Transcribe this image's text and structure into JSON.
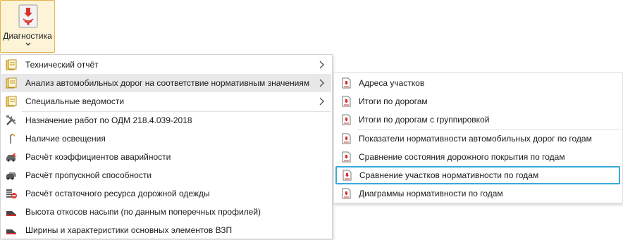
{
  "ribbon": {
    "label": "Диагностика"
  },
  "main_menu": {
    "items": [
      {
        "label": "Технический отчёт",
        "icon": "report-stack-icon",
        "submenu": true
      },
      {
        "label": "Анализ автомобильных дорог на соответствие нормативным значениям",
        "icon": "report-stack-icon",
        "submenu": true,
        "highlighted": true
      },
      {
        "label": "Специальные ведомости",
        "icon": "report-stack-icon",
        "submenu": true
      },
      {
        "label": "Назначение работ по ОДМ 218.4.039-2018",
        "icon": "tools-icon"
      },
      {
        "label": "Наличие освещения",
        "icon": "street-light-icon"
      },
      {
        "label": "Расчёт коэффициентов аварийности",
        "icon": "accident-icon"
      },
      {
        "label": "Расчёт пропускной способности",
        "icon": "car-traffic-icon"
      },
      {
        "label": "Расчёт остаточного ресурса дорожной одежды",
        "icon": "pavement-resource-icon"
      },
      {
        "label": "Высота откосов насыпи (по данным поперечных профилей)",
        "icon": "road-profile-icon"
      },
      {
        "label": "Ширины и характеристики основных элементов ВЗП",
        "icon": "road-profile-icon"
      }
    ]
  },
  "sub_menu": {
    "items": [
      {
        "label": "Адреса участков",
        "icon": "document-icon"
      },
      {
        "label": "Итоги по дорогам",
        "icon": "document-icon"
      },
      {
        "label": "Итоги по дорогам с группировкой",
        "icon": "document-icon"
      },
      {
        "label": "Показатели нормативности автомобильных дорог по годам",
        "icon": "document-icon"
      },
      {
        "label": "Сравнение состояния дорожного покрытия по годам",
        "icon": "document-icon"
      },
      {
        "label": "Сравнение участков нормативности по годам",
        "icon": "document-icon",
        "focused": true
      },
      {
        "label": "Диаграммы нормативности по годам",
        "icon": "document-icon"
      }
    ]
  },
  "colors": {
    "ribbon_border": "#e3b34a",
    "ribbon_bg": "#fdf4d8",
    "focus": "#3ba9d9",
    "highlight": "#e8e8e8",
    "accent_red": "#d9302c"
  }
}
